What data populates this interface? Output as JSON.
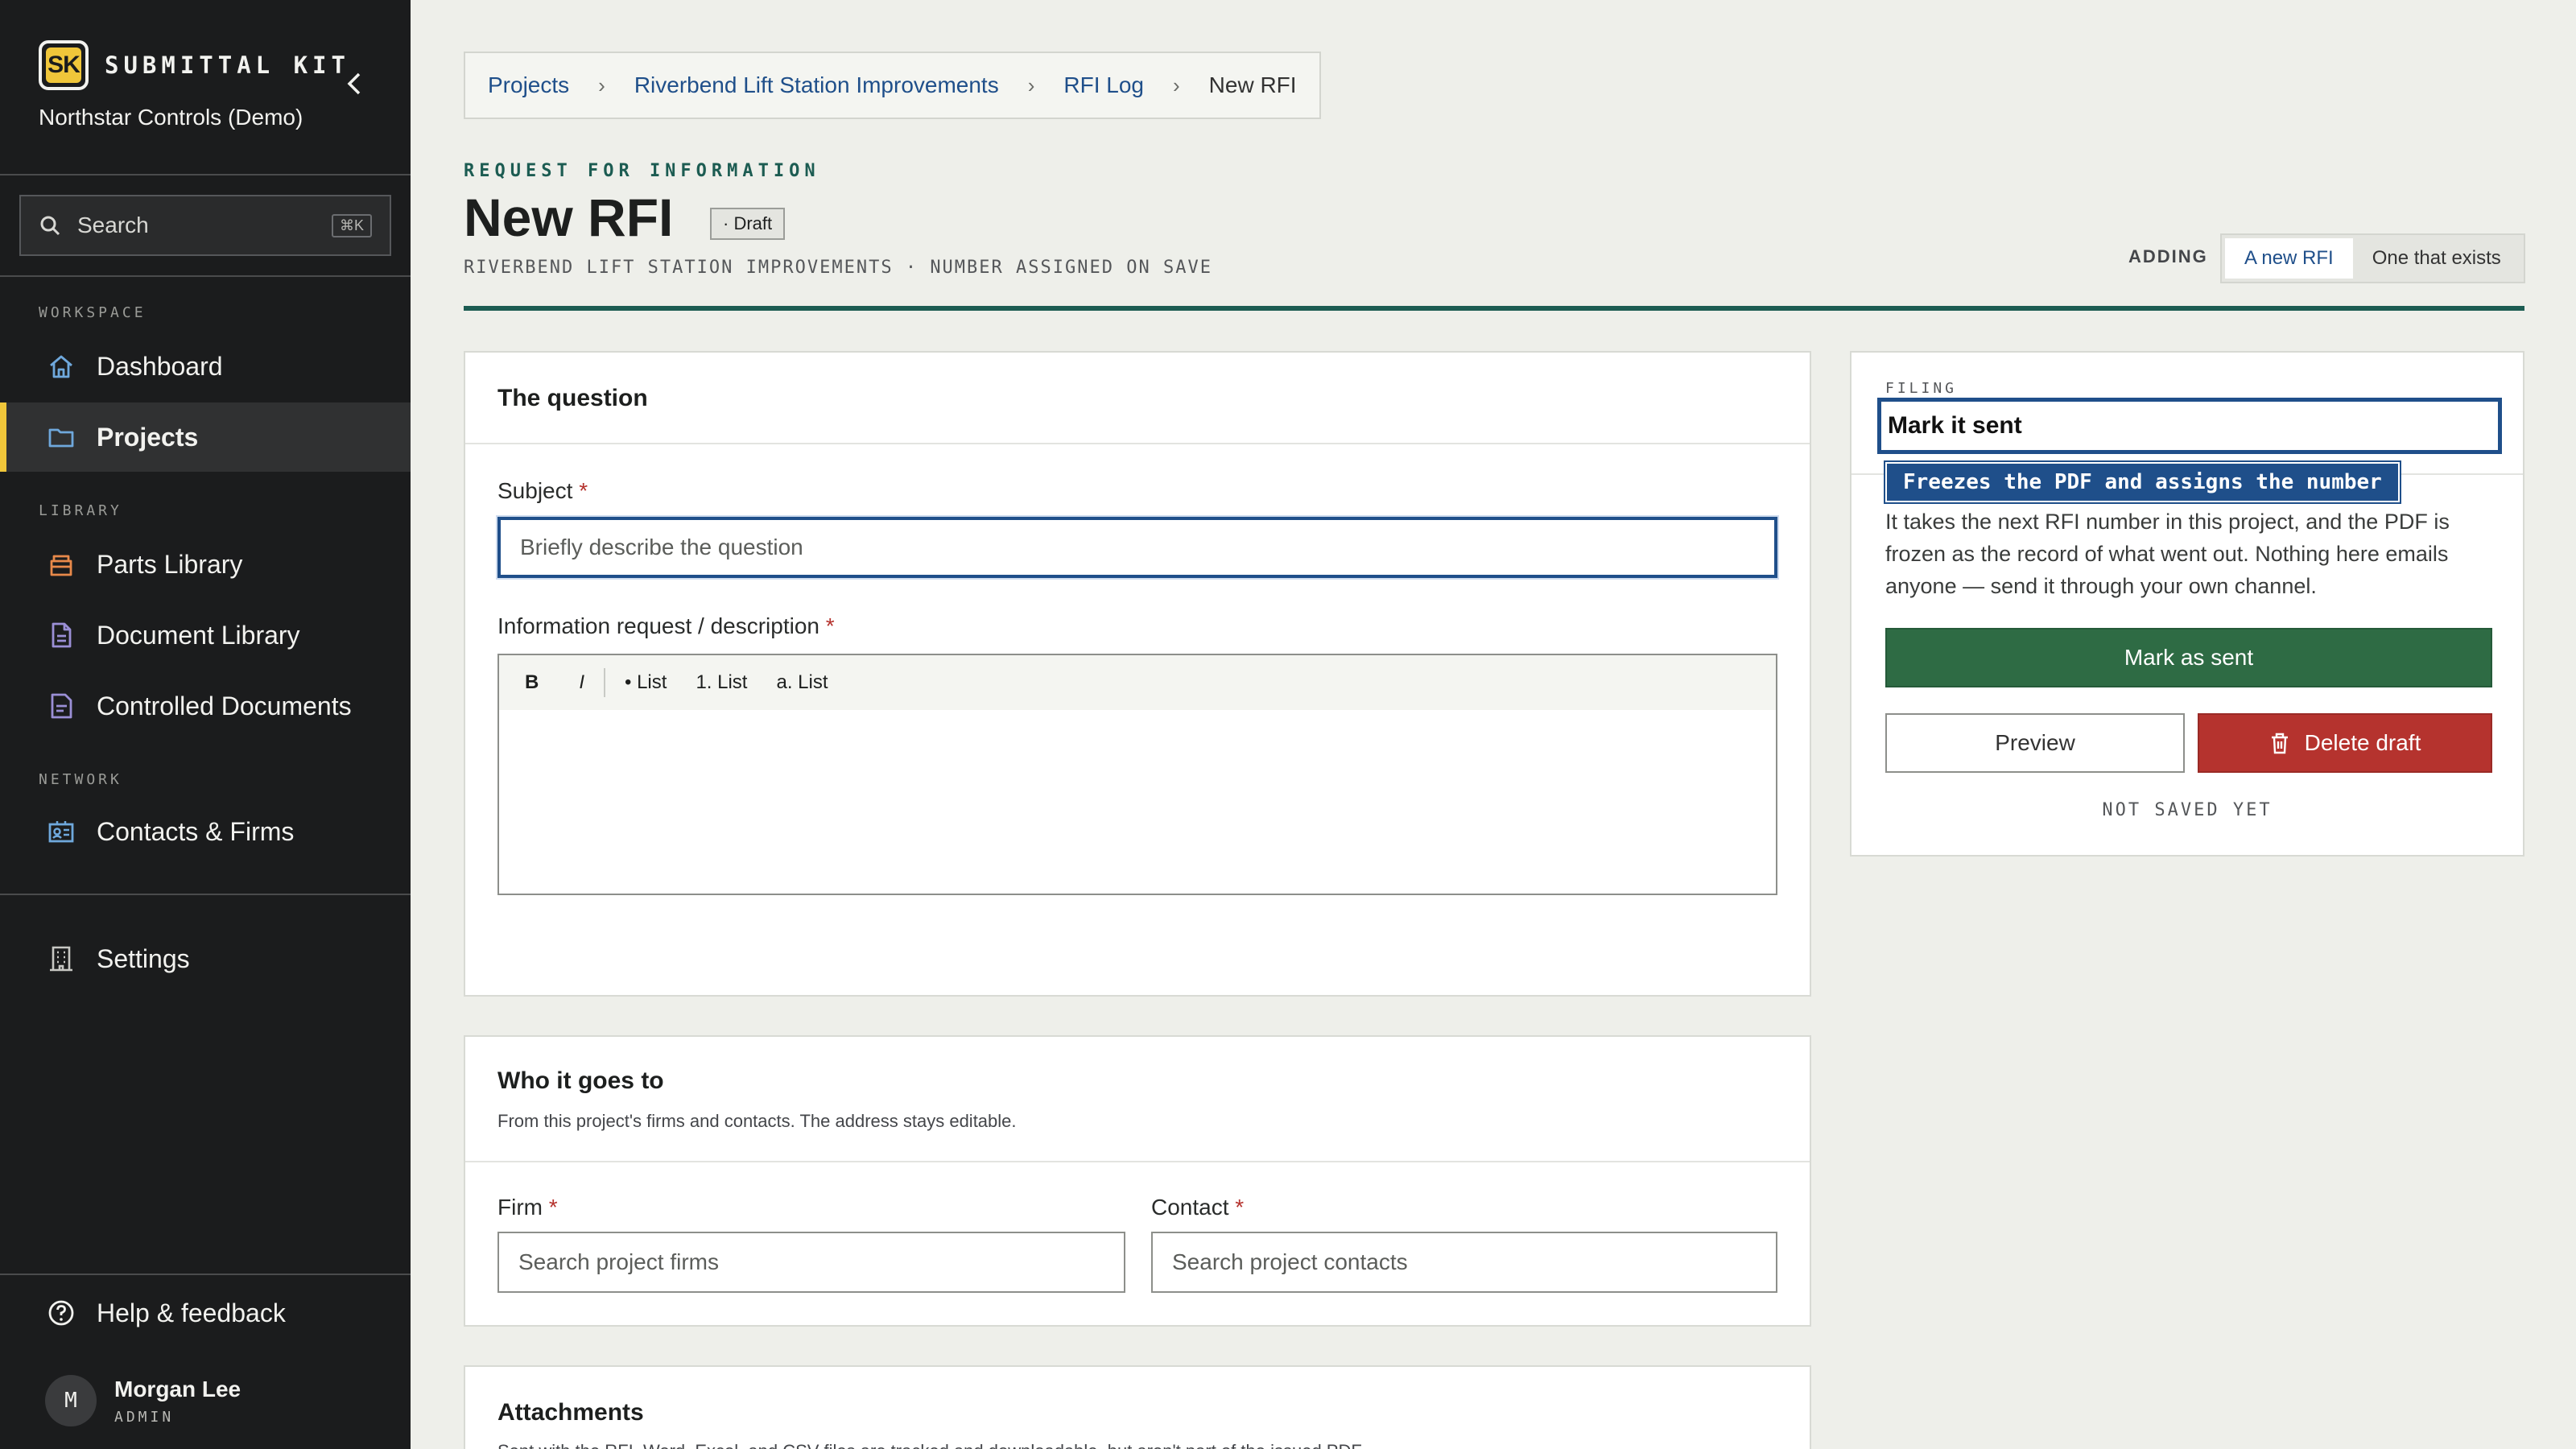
{
  "app": {
    "brand_logo": "SK",
    "brand_name": "SUBMITTAL KIT",
    "org": "Northstar Controls (Demo)"
  },
  "search": {
    "label": "Search",
    "shortcut": "⌘K"
  },
  "sidebar": {
    "sections": {
      "workspace": "WORKSPACE",
      "library": "LIBRARY",
      "network": "NETWORK"
    },
    "items": {
      "dashboard": "Dashboard",
      "projects": "Projects",
      "parts": "Parts Library",
      "documents": "Document Library",
      "controlled": "Controlled Documents",
      "contacts": "Contacts & Firms",
      "settings": "Settings",
      "help": "Help & feedback"
    },
    "accent": "#f0c63a"
  },
  "user": {
    "initial": "M",
    "name": "Morgan Lee",
    "role": "ADMIN"
  },
  "breadcrumb": [
    "Projects",
    "Riverbend Lift Station Improvements",
    "RFI Log",
    "New RFI"
  ],
  "header": {
    "eyebrow": "REQUEST FOR INFORMATION",
    "title": "New RFI",
    "badge": "· Draft",
    "subline": "RIVERBEND LIFT STATION IMPROVEMENTS · NUMBER ASSIGNED ON SAVE",
    "adding_label": "ADDING",
    "adding_options": [
      "A new RFI",
      "One that exists"
    ],
    "adding_selected": "A new RFI"
  },
  "question": {
    "heading": "The question",
    "subject_label": "Subject",
    "subject_placeholder": "Briefly describe the question",
    "description_label": "Information request / description",
    "toolbar": {
      "bold": "B",
      "italic": "I",
      "bullet": "• List",
      "numbered": "1. List",
      "alpha": "a. List"
    }
  },
  "recipient": {
    "heading": "Who it goes to",
    "note": "From this project's firms and contacts. The address stays editable.",
    "firm_label": "Firm",
    "firm_placeholder": "Search project firms",
    "contact_label": "Contact",
    "contact_placeholder": "Search project contacts"
  },
  "attachments": {
    "heading": "Attachments",
    "note": "Sent with the RFI. Word, Excel, and CSV files are tracked and downloadable, but aren't part of the issued PDF."
  },
  "filing": {
    "label": "FILING",
    "selected": "Mark it sent",
    "tooltip": "Freezes the PDF and assigns the number",
    "description": "It takes the next RFI number in this project, and the PDF is frozen as the record of what went out. Nothing here emails anyone — send it through your own channel.",
    "primary": "Mark as sent",
    "preview": "Preview",
    "delete": "Delete draft",
    "status": "NOT SAVED YET"
  },
  "colors": {
    "primary": "#2e6b44",
    "danger": "#b5332e",
    "link": "#1f4f8a",
    "teal": "#1c5c52"
  }
}
